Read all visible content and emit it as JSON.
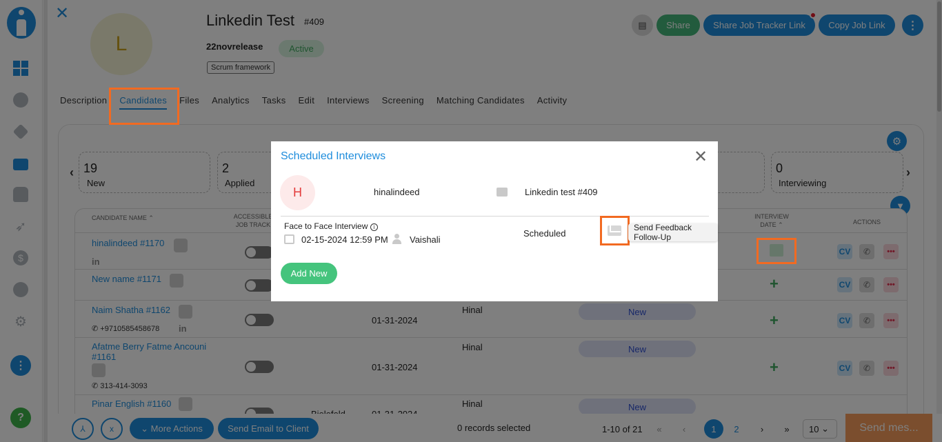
{
  "header": {
    "avatar_initial": "L",
    "title": "Linkedin Test",
    "id": "#409",
    "client": "22novrelease",
    "status": "Active",
    "tag": "Scrum framework",
    "buttons": {
      "share": "Share",
      "share_tracker": "Share Job Tracker Link",
      "copy_link": "Copy Job Link"
    }
  },
  "tabs": [
    "Description",
    "Candidates",
    "Files",
    "Analytics",
    "Tasks",
    "Edit",
    "Interviews",
    "Screening",
    "Matching Candidates",
    "Activity"
  ],
  "stats": [
    {
      "num": "19",
      "label": "New"
    },
    {
      "num": "2",
      "label": "Applied"
    },
    {
      "num": "0",
      "label": "Interviewing"
    }
  ],
  "table": {
    "headers": {
      "candidate_name": "CANDIDATE NAME",
      "accessible": "ACCESSIBLE",
      "job_track": "JOB TRACK",
      "interview": "INTERVIEW",
      "date": "DATE",
      "actions": "ACTIONS"
    },
    "rows": [
      {
        "name": "hinalindeed #1170",
        "phone": "",
        "city": "",
        "date": "",
        "owner": "",
        "stage": ""
      },
      {
        "name": "New name #1171",
        "phone": "",
        "city": "",
        "date": "",
        "owner": "",
        "stage": ""
      },
      {
        "name": "Naim Shatha #1162",
        "phone": "+9710585458678",
        "city": "",
        "date": "01-31-2024",
        "owner": "Hinal",
        "stage": "New"
      },
      {
        "name_line1": "Afatme Berry Fatme Ancouni",
        "name_line2": "#1161",
        "phone": "313-414-3093",
        "city": "",
        "date": "01-31-2024",
        "owner": "Hinal",
        "stage": "New"
      },
      {
        "name": "Pinar English #1160",
        "phone": "",
        "city": "Bielefeld",
        "date": "01-31-2024",
        "owner": "Hinal",
        "stage": "New"
      }
    ],
    "linkedin": "in",
    "cv": "CV"
  },
  "modal": {
    "title": "Scheduled Interviews",
    "avatar_initial": "H",
    "candidate": "hinalindeed",
    "job": "Linkedin test #409",
    "interview_type": "Face to Face Interview",
    "datetime": "02-15-2024 12:59 PM",
    "interviewer": "Vaishali",
    "status": "Scheduled",
    "tooltip": "Send Feedback Follow-Up",
    "add_new": "Add New"
  },
  "footer": {
    "more_actions": "More Actions",
    "send_email": "Send Email to Client",
    "records_selected": "0 records selected",
    "page_info": "1-10 of 21",
    "pages": [
      "1",
      "2"
    ],
    "per_page": "10",
    "send_message": "Send mes..."
  },
  "colors": {
    "accent": "#1f8ddc",
    "highlight": "#f26a21",
    "success": "#45c47d",
    "send": "#f79d5c"
  }
}
